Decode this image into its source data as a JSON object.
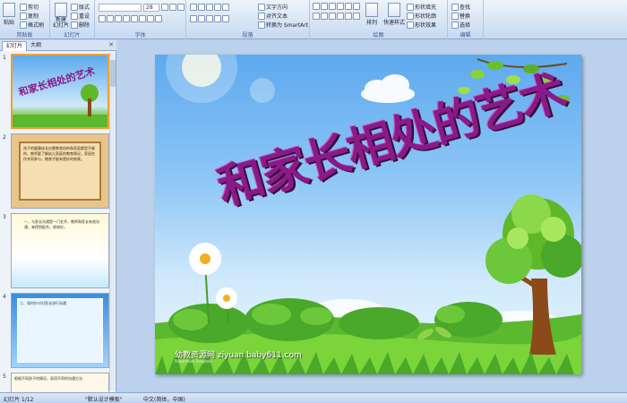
{
  "ribbon": {
    "clipboard": {
      "label": "剪贴板",
      "paste": "粘贴",
      "cut": "剪切",
      "copy": "复制",
      "format": "格式刷"
    },
    "slides": {
      "label": "幻灯片",
      "new": "新建\n幻灯片",
      "layout": "版式",
      "reset": "重设",
      "delete": "删除"
    },
    "font": {
      "label": "字体",
      "font_value": "",
      "size_value": "28"
    },
    "paragraph": {
      "label": "段落",
      "text_dir": "文字方向",
      "align": "对齐文本",
      "smartart": "转换为 SmartArt"
    },
    "drawing": {
      "label": "绘图",
      "arrange": "排列",
      "quick_styles": "快速样式",
      "fill": "形状填充",
      "outline": "形状轮廓",
      "effects": "形状效果"
    },
    "editing": {
      "label": "编辑",
      "find": "查找",
      "replace": "替换",
      "select": "选择"
    }
  },
  "pane_tabs": {
    "slides": "幻灯片",
    "outline": "大纲"
  },
  "thumbs": [
    {
      "num": "1",
      "title": "和家长相处的艺术"
    },
    {
      "num": "2",
      "text": "孩子的健康成长仅靠教育机构和家庭都是不够的，教师要了解幼儿家庭的教育情况，家园合作共同参与，教育才能有更好的效果。"
    },
    {
      "num": "3",
      "text": "一、与家长沟通是一门艺术，教师和家长有效沟通，来得到配合，收效好。"
    },
    {
      "num": "4",
      "text": "二、如何针对对家长进行沟通"
    },
    {
      "num": "5",
      "text": "根据不同孩子的情况，采用不同的沟通方法"
    }
  ],
  "slide": {
    "title": "和家长相处的艺术",
    "watermark": "幼教资源网 ziyuan.baby611.com",
    "watermark_sub": "PowerPoint Template"
  },
  "status": {
    "page": "幻灯片 1/12",
    "theme": "\"默认设计模板\"",
    "lang": "中文(简体，中国)"
  }
}
